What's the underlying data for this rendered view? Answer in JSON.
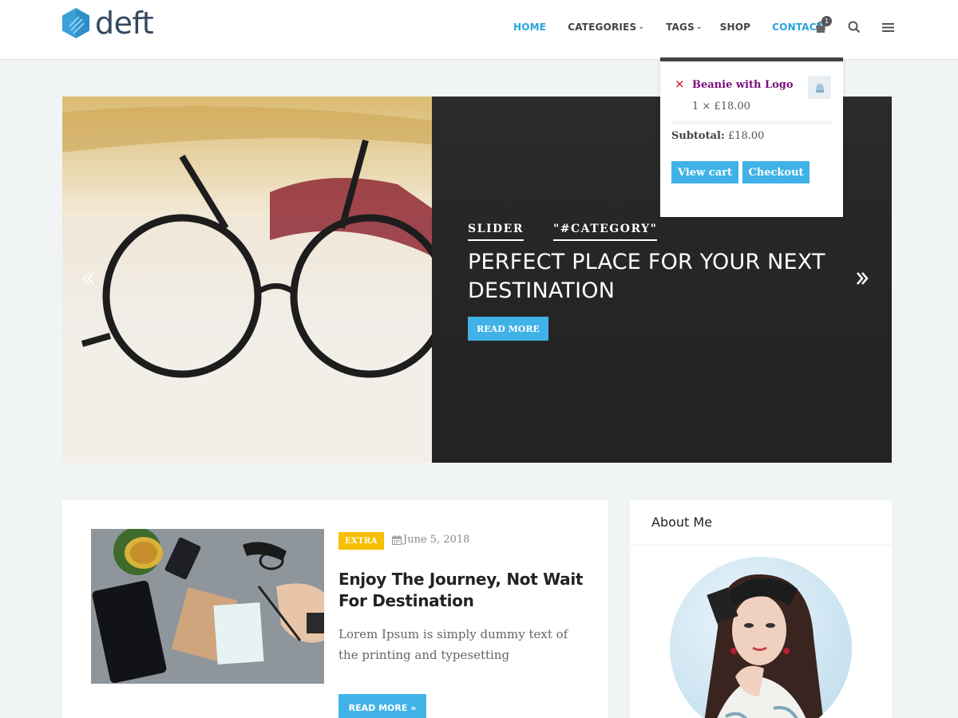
{
  "brand": {
    "name": "deft",
    "accent": "#29a3dc",
    "button_color": "#40b2e8"
  },
  "nav": {
    "items": [
      {
        "label": "HOME",
        "active": true,
        "has_dropdown": false
      },
      {
        "label": "CATEGORIES",
        "active": false,
        "has_dropdown": true
      },
      {
        "label": "TAGS",
        "active": false,
        "has_dropdown": true
      },
      {
        "label": "SHOP",
        "active": false,
        "has_dropdown": false
      },
      {
        "label": "CONTACT",
        "active": true,
        "has_dropdown": false
      }
    ],
    "cart_count": "1",
    "icons": [
      "cart-icon",
      "search-icon",
      "menu-icon"
    ]
  },
  "mini_cart": {
    "remove_symbol": "×",
    "item_name": "Beanie with Logo",
    "item_qty_price": "1 × £18.00",
    "subtotal_label": "Subtotal:",
    "subtotal_value": "£18.00",
    "view_cart_label": "View cart",
    "checkout_label": "Checkout"
  },
  "hero": {
    "tags": [
      "SLIDER",
      "\"#CATEGORY\""
    ],
    "title": "PERFECT PLACE FOR YOUR NEXT DESTINATION",
    "button_label": "READ MORE"
  },
  "post": {
    "badge": "EXTRA",
    "badge_color": "#f6c000",
    "date": "June 5, 2018",
    "title": "Enjoy The Journey, Not Wait For Destination",
    "excerpt": "Lorem Ipsum  is simply dummy text of the printing and typesetting",
    "button_label": "READ MORE »"
  },
  "sidebar": {
    "about_title": "About Me"
  }
}
